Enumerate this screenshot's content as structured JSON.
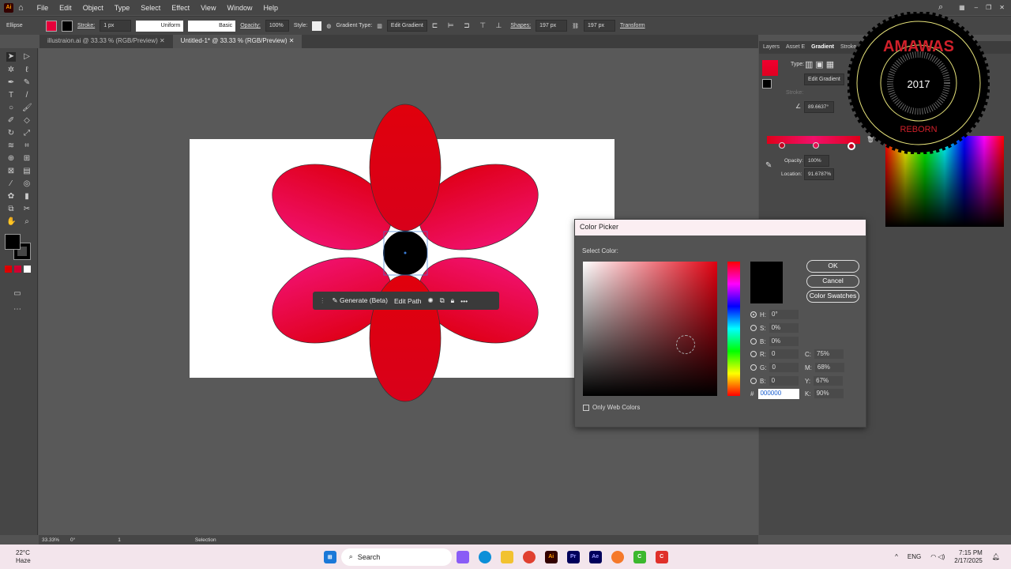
{
  "menu": {
    "items": [
      "File",
      "Edit",
      "Object",
      "Type",
      "Select",
      "Effect",
      "View",
      "Window",
      "Help"
    ]
  },
  "control": {
    "selection": "Ellipse",
    "stroke_label": "Stroke:",
    "stroke_value": "1 px",
    "profile": "Uniform",
    "brush": "Basic",
    "opacity_label": "Opacity:",
    "opacity": "100%",
    "style_label": "Style:",
    "gradient_type_label": "Gradient Type:",
    "edit_gradient": "Edit Gradient",
    "shapes_label": "Shapes:",
    "width": "197 px",
    "height": "197 px",
    "transform": "Transform"
  },
  "tabs": [
    {
      "label": "illustraion.ai @ 33.33 % (RGB/Preview)"
    },
    {
      "label": "Untitled-1* @ 33.33 % (RGB/Preview)"
    }
  ],
  "context_bar": {
    "generate": "Generate (Beta)",
    "edit_path": "Edit Path"
  },
  "panel": {
    "tabs": [
      "Layers",
      "Asset E",
      "Gradient",
      "Stroke"
    ],
    "type_label": "Type:",
    "edit_gradient": "Edit Gradient",
    "stroke_label": "Stroke:",
    "angle": "89.6637°",
    "opacity_label": "Opacity:",
    "opacity": "100%",
    "location_label": "Location:",
    "location": "91.6787%"
  },
  "watermark": {
    "top": "AMAWAS",
    "year": "2017",
    "bottom": "REBORN"
  },
  "dialog": {
    "title": "Color Picker",
    "select_label": "Select Color:",
    "ok": "OK",
    "cancel": "Cancel",
    "swatches": "Color Swatches",
    "only_web": "Only Web Colors",
    "fields": {
      "H": "0°",
      "S": "0%",
      "B": "0%",
      "R": "0",
      "G": "0",
      "B2": "0",
      "C": "75%",
      "M": "68%",
      "Y": "67%",
      "K": "90%",
      "hex": "000000"
    }
  },
  "status": {
    "zoom": "33.33%",
    "rotation": "0°",
    "page": "1",
    "tool": "Selection"
  },
  "taskbar": {
    "weather_temp": "22°C",
    "weather_desc": "Haze",
    "search": "Search",
    "lang": "ENG",
    "time": "7:15 PM",
    "date": "2/17/2025"
  },
  "colors": {
    "accent": "#e6003a",
    "petal_top": "#e00010",
    "petal_side": "#f0105a"
  }
}
